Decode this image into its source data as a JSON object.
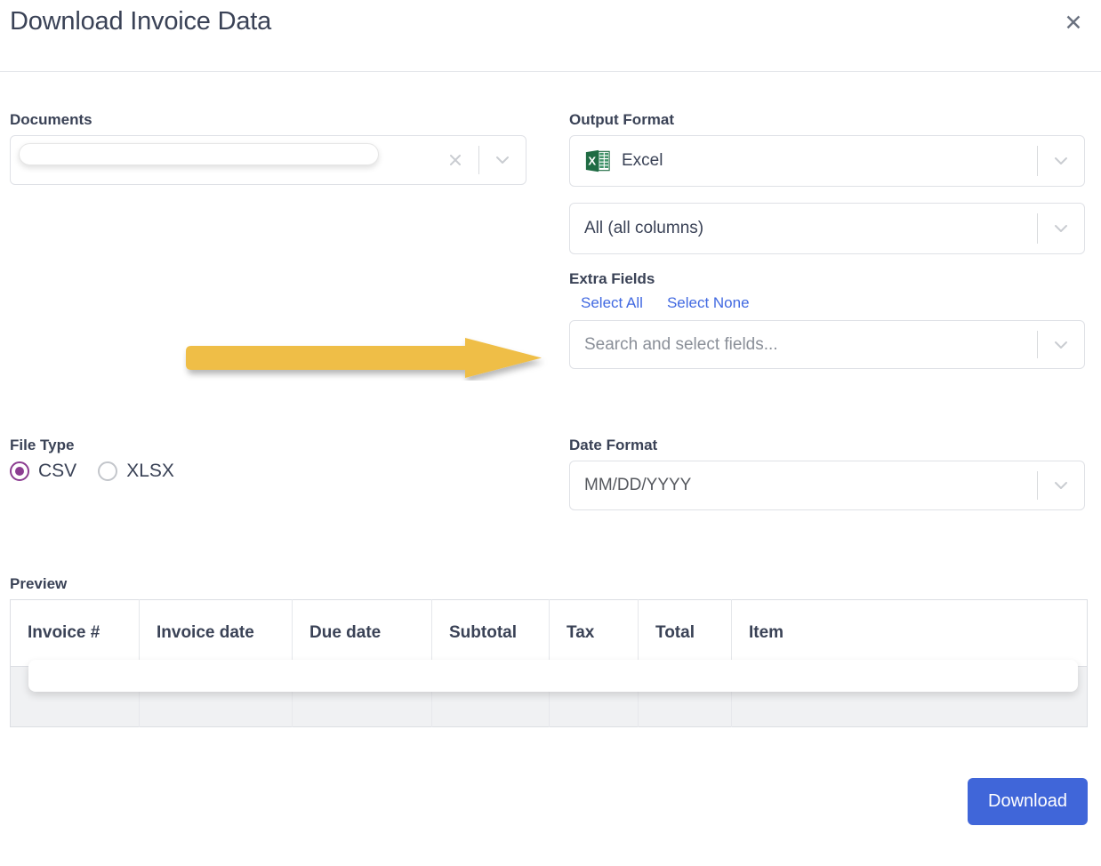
{
  "header": {
    "title": "Download Invoice Data",
    "close_label": "✕"
  },
  "documents": {
    "label": "Documents",
    "value": "",
    "clear_icon": "close-icon",
    "expand_icon": "chevron-down-icon"
  },
  "output_format": {
    "label": "Output Format",
    "format_value": "Excel",
    "format_icon": "excel-icon",
    "columns_value": "All (all columns)"
  },
  "extra_fields": {
    "label": "Extra Fields",
    "select_all": "Select All",
    "select_none": "Select None",
    "placeholder": "Search and select fields...",
    "value": ""
  },
  "file_type": {
    "label": "File Type",
    "options": [
      {
        "label": "CSV",
        "selected": true
      },
      {
        "label": "XLSX",
        "selected": false
      }
    ],
    "selected_color": "#8c3d91"
  },
  "date_format": {
    "label": "Date Format",
    "value": "MM/DD/YYYY"
  },
  "preview": {
    "label": "Preview",
    "columns": [
      "Invoice #",
      "Invoice date",
      "Due date",
      "Subtotal",
      "Tax",
      "Total",
      "Item"
    ],
    "rows": [
      {
        "invoice_number": "",
        "invoice_date": "",
        "due_date": "",
        "subtotal": "",
        "tax": "",
        "total": "",
        "item": ""
      }
    ]
  },
  "footer": {
    "download_label": "Download"
  },
  "annotation": {
    "type": "arrow-right",
    "color": "#efbe46"
  },
  "colors": {
    "accent_blue": "#4066d9",
    "link_blue": "#4169e1",
    "text_dark": "#3a4256",
    "radio_purple": "#8c3d91",
    "arrow_yellow": "#efbe46",
    "excel_green": "#1f6b43"
  }
}
